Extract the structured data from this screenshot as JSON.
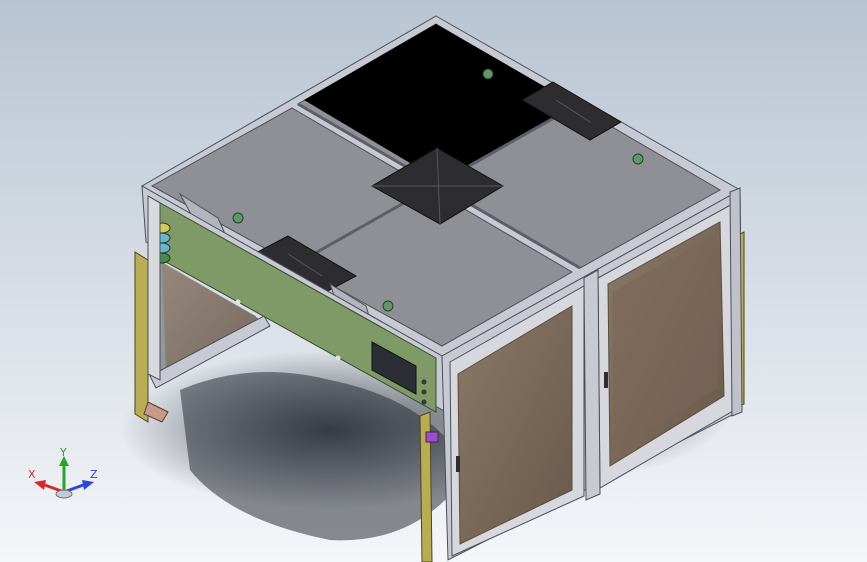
{
  "viewport": {
    "background_top": "#b9c4d2",
    "background_bottom": "#f4f6f9"
  },
  "triad": {
    "x_label": "X",
    "y_label": "Y",
    "z_label": "Z",
    "x_color": "#d42a2a",
    "y_color": "#2aa42a",
    "z_color": "#2a48d4"
  },
  "model": {
    "frame_color": "#a9aebb",
    "panel_color": "#8f8f96",
    "plate_color": "#2d2d30",
    "control_panel_color": "#7f9a66",
    "glass_color": "#7d6a5a",
    "leg_color": "#b8ad55"
  }
}
